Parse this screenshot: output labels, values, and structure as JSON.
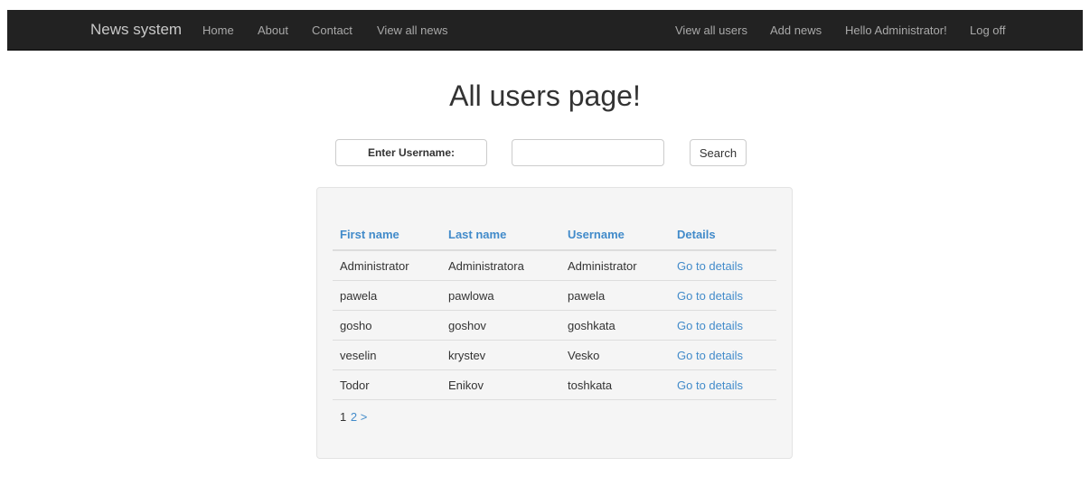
{
  "navbar": {
    "brand": "News system",
    "left_links": [
      "Home",
      "About",
      "Contact",
      "View all news"
    ],
    "right_links": [
      "View all users",
      "Add news",
      "Hello Administrator!",
      "Log off"
    ]
  },
  "page": {
    "title": "All users page!"
  },
  "search": {
    "label": "Enter Username:",
    "value": "",
    "button_label": "Search"
  },
  "table": {
    "headers": [
      "First name",
      "Last name",
      "Username",
      "Details"
    ],
    "rows": [
      [
        "Administrator",
        "Administratora",
        "Administrator",
        "Go to details"
      ],
      [
        "pawela",
        "pawlowa",
        "pawela",
        "Go to details"
      ],
      [
        "gosho",
        "goshov",
        "goshkata",
        "Go to details"
      ],
      [
        "veselin",
        "krystev",
        "Vesko",
        "Go to details"
      ],
      [
        "Todor",
        "Enikov",
        "toshkata",
        "Go to details"
      ]
    ]
  },
  "pagination": {
    "current": "1",
    "page2": "2",
    "next": ">"
  },
  "colors": {
    "navbar_bg": "#222222",
    "link_blue": "#428bca",
    "well_bg": "#f5f5f5"
  }
}
